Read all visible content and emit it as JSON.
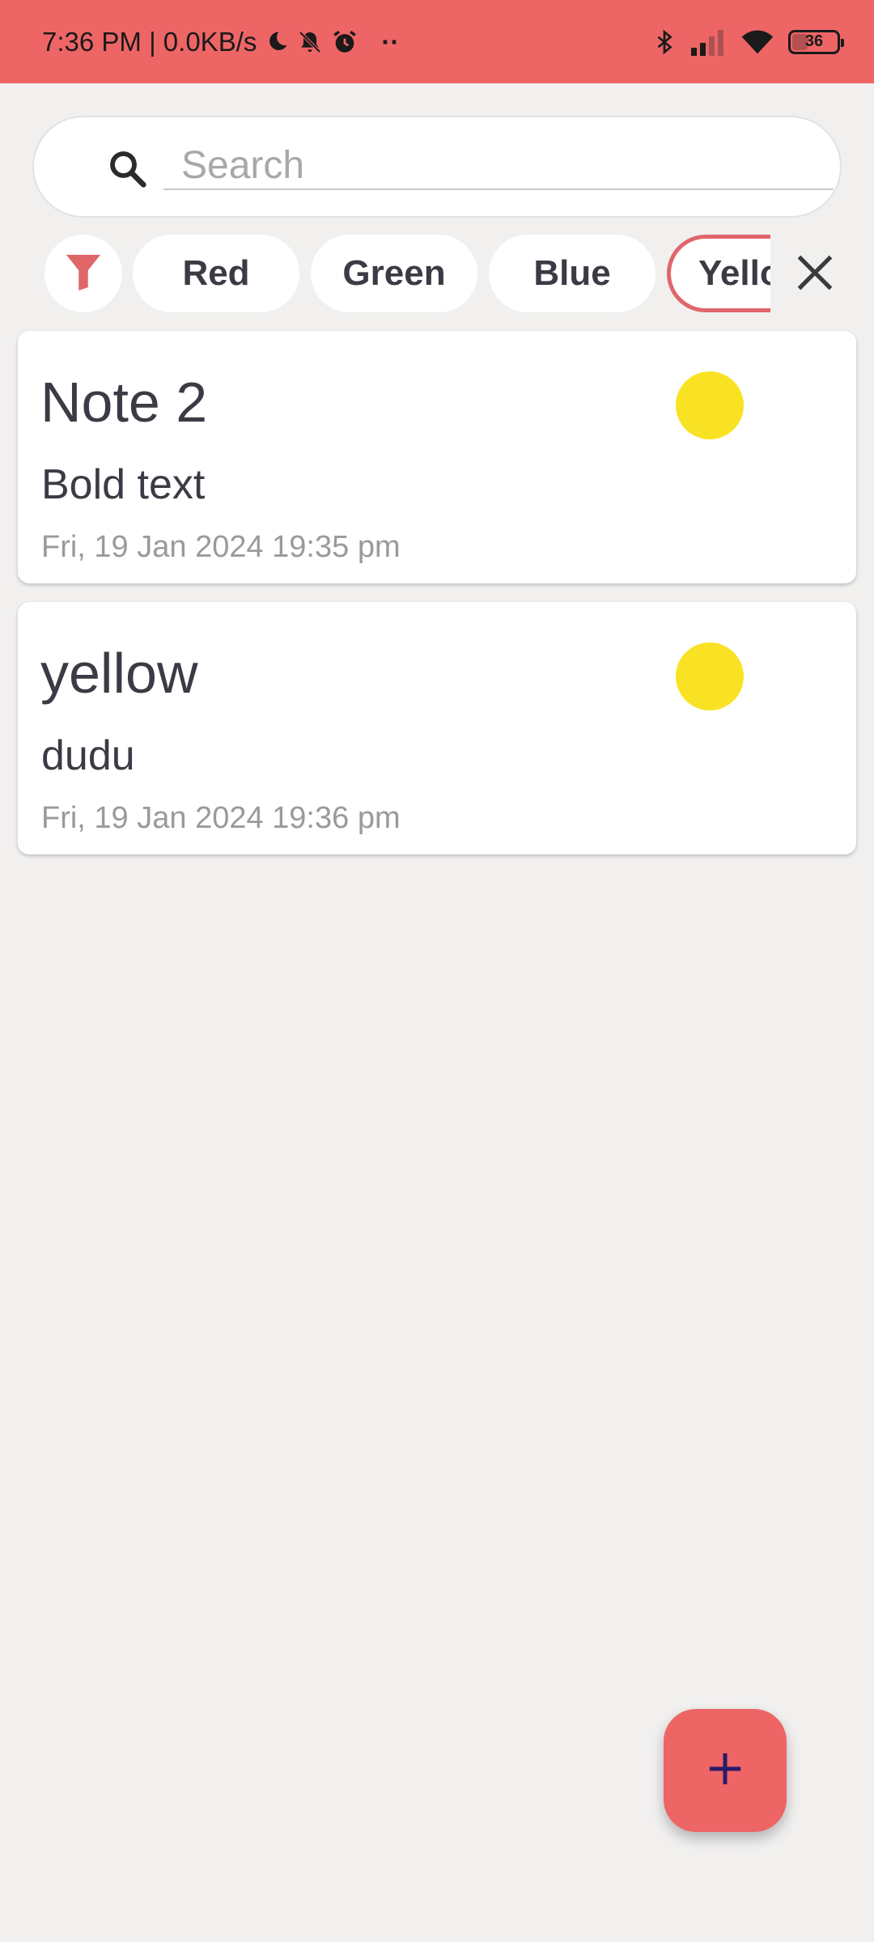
{
  "status_bar": {
    "time_speed": "7:36 PM | 0.0KB/s",
    "overflow_dots": "··",
    "battery_level": "36",
    "battery_fraction": 0.36
  },
  "search": {
    "placeholder": "Search",
    "value": ""
  },
  "filter": {
    "chips": [
      {
        "label": "Red"
      },
      {
        "label": "Green"
      },
      {
        "label": "Blue"
      },
      {
        "label": "Yellow",
        "selected": true
      }
    ]
  },
  "notes": [
    {
      "title": "Note 2",
      "body": "Bold text",
      "date": "Fri, 19 Jan 2024 19:35 pm",
      "color": "#f9e223"
    },
    {
      "title": "yellow",
      "body": "dudu",
      "date": "Fri, 19 Jan 2024 19:36 pm",
      "color": "#f9e223"
    }
  ],
  "colors": {
    "accent": "#ee6566",
    "background": "#f1f0ef",
    "card": "#ffffff",
    "text_primary": "#3b3b45",
    "text_secondary": "#9a9a9a",
    "fab_icon": "#2a1a6a"
  },
  "icons": {
    "search": "search-icon",
    "filter": "funnel-icon",
    "clear": "close-icon",
    "add": "plus-icon"
  }
}
